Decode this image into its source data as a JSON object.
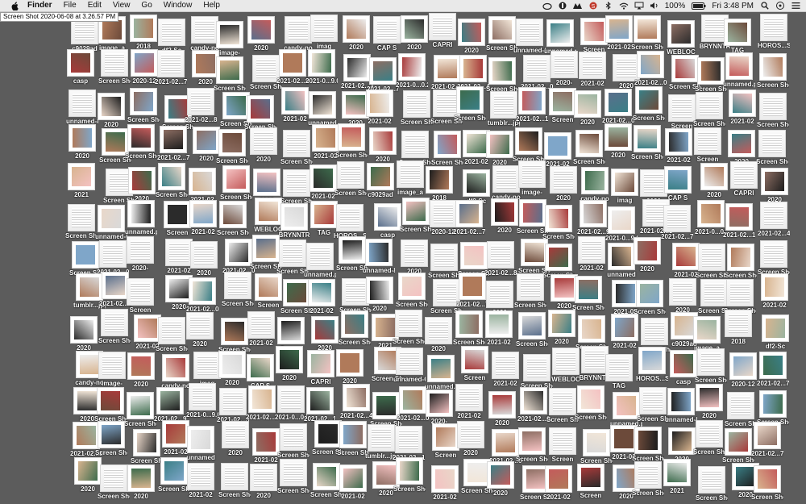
{
  "menubar": {
    "app": "Finder",
    "menus": [
      "File",
      "Edit",
      "View",
      "Go",
      "Window",
      "Help"
    ],
    "battery": "100%",
    "clock": "Fri 3:48 PM",
    "status_icons": [
      "creative-cloud-icon",
      "vpn-icon",
      "mail-icon",
      "music-icon",
      "bluetooth-icon",
      "wifi-icon",
      "airplay-icon",
      "volume-icon",
      "battery-icon",
      "search-icon",
      "control-center-icon",
      "siri-icon"
    ]
  },
  "tooltip": "Screen Shot 2020-06-08 at 3.26.57 PM",
  "desktop_labels": [
    "c9029ad",
    "image_a",
    "2018",
    "df2-Sc",
    "candy-no",
    "image-",
    "2020",
    "candy-no",
    "imag",
    "2020",
    "CAP S",
    "2020",
    "CAPRI",
    "2020",
    "Screen Shot",
    "unnamed-6",
    "unnamed.png",
    "Screen",
    "2021-02",
    "Screen Shot",
    "WEBLOC",
    "BRYNNTR",
    "TAG",
    "HOROS...STORIES",
    "casp",
    "Screen Shot",
    "2020-12",
    "2021-02...7.53",
    "2020",
    "Screen Shot",
    "Screen Shot",
    "2021-02...9.57 PM",
    "2021-0...9.03 PM",
    "2021-02...3.47 PM",
    "2021-02...7.30 PM",
    "2021-0...0.28 P",
    "2021-02...1.00 PM",
    "2021-02...4.20",
    "Screen Shot",
    "2021-02...09.1",
    "2020-",
    "2021-02",
    "2020",
    "2021-02...0.87",
    "Screen Shot",
    "Screen Shot",
    "unnamed.png",
    "Screen Shot",
    "unnamed-8",
    "2020",
    "Screen Shot",
    "Screen Shot",
    "2021-02...8.55",
    "Screen Shot",
    "Screen Shot",
    "2021-02",
    "unnamed",
    "2020",
    "2021-02",
    "Screen Shot",
    "Screen Shot",
    "Screen Shot",
    "tumblr...jpg",
    "2021-02...1.00",
    "Screen",
    "2020",
    "2021-02...07.52 PM",
    "Screen Shot",
    "Screen",
    "Screen Shot",
    "2021-02",
    "Screen Shot",
    "2020",
    "Screen Shot",
    "Screen Shot",
    "2021-02...7.70 PM",
    "2020",
    "Screen Shot",
    "2020",
    "Screen Shot",
    "2021-02",
    "Screen Shot",
    "2020",
    "Screen Shot",
    "Screen Shot",
    "2021-02",
    "2020",
    "Screen Shot",
    "2021-02",
    "Screen Shot",
    "2020",
    "Screen Shot",
    "2021-02",
    "Screen",
    "2020",
    "Screen Shot",
    "2021",
    "Screen Shot",
    "2020",
    "Screen Shot",
    "2021-02",
    "Screen Shot",
    "2020",
    "Screen Shot",
    "2021-02",
    "Screen Shot"
  ],
  "colors": {
    "desktop": "#5c5c5c",
    "menubar": "#e9e9e9",
    "label_text": "#ffffff"
  }
}
